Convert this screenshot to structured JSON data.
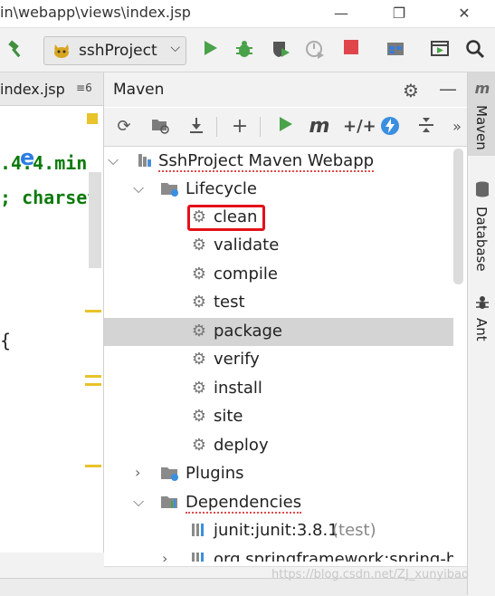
{
  "window": {
    "title": "in\\webapp\\views\\index.jsp",
    "minimize": "—",
    "restore": "❐",
    "close": "✕"
  },
  "toolbar": {
    "project": "sshProject",
    "icons": [
      "hammer-icon",
      "run-icon",
      "debug-icon",
      "coverage-icon",
      "profile-icon",
      "stop-icon",
      "project-structure-icon",
      "presentation-icon",
      "search-icon"
    ]
  },
  "editor": {
    "tab_label": "index.jsp",
    "tab_count": "6",
    "code_lines": [
      ".4.4.min",
      "; charset",
      "{"
    ]
  },
  "maven": {
    "title": "Maven",
    "toolbar_icons": [
      "refresh-icon",
      "reimport-icon",
      "download-icon",
      "add-icon",
      "run-icon",
      "maven-goal-icon",
      "skip-tests-icon",
      "offline-icon",
      "collapse-icon",
      "more-icon"
    ],
    "tree": {
      "root": "SshProject Maven Webapp",
      "lifecycle_label": "Lifecycle",
      "phases": [
        "clean",
        "validate",
        "compile",
        "test",
        "package",
        "verify",
        "install",
        "site",
        "deploy"
      ],
      "selected_phase": "package",
      "highlighted_phase": "clean",
      "plugins_label": "Plugins",
      "dependencies_label": "Dependencies",
      "dependencies": [
        {
          "name": "junit:junit:3.8.1",
          "scope": "(test)"
        },
        {
          "name": "org.springframework:spring-bea",
          "scope": ""
        }
      ]
    }
  },
  "side_tabs": [
    "Maven",
    "Database",
    "Ant"
  ],
  "watermark": "https://blog.csdn.net/ZJ_xunyibao"
}
